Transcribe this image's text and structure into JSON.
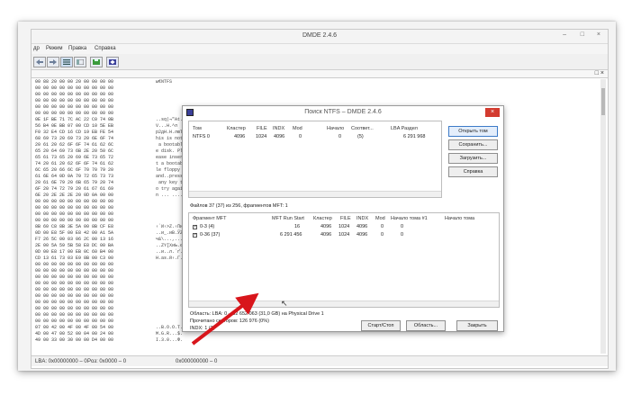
{
  "app": {
    "title": "DMDE 2.4.6",
    "window_controls": [
      "–",
      "□",
      "×"
    ],
    "menu": [
      "др",
      "Режим",
      "Правка",
      "Справка"
    ],
    "mdi_controls": "□ ×",
    "status": {
      "lba": "LBA: 0x00000000 – 0",
      "pos": "Poз: 0x0000 – 0",
      "offset": "0x000000000 – 0"
    }
  },
  "hex": {
    "rows": [
      "00 88 20 00 00 20 00 00 00 00",
      "00 00 00 00 00 00 00 00 00 00",
      "00 00 00 00 00 00 00 00 00 00",
      "00 00 00 00 00 00 00 00 00 00",
      "00 00 00 00 00 00 00 00 00 00",
      "00 00 00 00 00 00 00 00 00 00",
      "0E 1F BE 71 7C AC 22 C0 74 0B",
      "56 B4 0E BB 07 00 CD 10 5E EB",
      "F0 32 E4 CD 16 CD 19 EB FE 54",
      "68 69 73 20 69 73 20 6E 6F 74",
      "20 61 20 62 6F 6F 74 61 62 6C",
      "65 20 64 69 73 6B 2E 20 50 6C",
      "65 61 73 65 20 69 6E 73 65 72",
      "74 20 61 20 62 6F 6F 74 61 62",
      "6C 65 20 66 6C 6F 70 70 79 20",
      "61 6E 64 0D 0A 70 72 65 73 73",
      "20 61 6E 79 20 6B 65 79 20 74",
      "6F 20 74 72 79 20 61 67 61 69",
      "6E 20 2E 2E 2E 20 0D 0A 00 00",
      "00 00 00 00 00 00 00 00 00 00",
      "00 00 00 00 00 00 00 00 00 00",
      "00 00 00 00 00 00 00 00 00 00",
      "00 00 00 00 00 00 00 00 00 00",
      "8B 60 C8 8B 3E 5A 00 8B CF E8",
      "0D 00 E8 5F 00 E8 42 00 A1 5A",
      "F7 26 5C 00 03 06 2C 00 13 16",
      "2E 00 5A 59 5B 58 E8 DC 00 BA",
      "0D 00 E8 17 00 EB 0C 60 B4 00",
      "CD 13 61 73 03 E9 8B 00 C3 00",
      "00 00 00 00 00 00 00 00 00 00",
      "00 00 00 00 00 00 00 00 00 00",
      "00 00 00 00 00 00 00 00 00 00",
      "00 00 00 00 00 00 00 00 00 00",
      "00 00 00 00 00 00 00 00 00 00",
      "00 00 00 00 00 00 00 00 00 00",
      "00 00 00 00 00 00 00 00 00 00",
      "00 00 00 00 00 00 00 00 00 00",
      "00 00 00 00 00 00 00 00 00 00",
      "00 00 00 00 00 00 00 00 00 00",
      "07 00 42 00 4F 00 4F 00 54 00",
      "4D 00 47 00 52 00 04 00 24 00",
      "49 00 33 00 30 00 00 D4 00 00"
    ],
    "ascii": [
      "ы€NTFS",
      "",
      "",
      "",
      "",
      "",
      "..ѕq|¬\"Аt.",
      "V...Н.^л",
      "р2дН.Н.люT",
      "his is not",
      " a bootabl",
      "e disk. Pl",
      "ease inser",
      "t a bootab",
      "le floppy ",
      "and..press",
      " any key t",
      "o try agai",
      "n ... ....",
      "",
      "",
      "",
      "",
      "‹`И‹>Z.‹Пи",
      "..и_.иB.ЎZ",
      "ч&\\...,...",
      "..ZY[XиЬ.є",
      "..и..л.`ґ.",
      "Н.as.й‹.Г.",
      "",
      "",
      "",
      "",
      "",
      "",
      "",
      "",
      "",
      "",
      "..B.O.O.T.",
      "M.G.R...$.",
      "I.3.0...Ф."
    ]
  },
  "dialog": {
    "title": "Поиск NTFS – DMDE 2.4.6",
    "close": "×",
    "top_list": {
      "headers": [
        "Том",
        "Кластер",
        "FILE",
        "INDX",
        "Mod",
        "Начало",
        "Соответ...",
        "LBA Раздел"
      ],
      "rows": [
        [
          "NTFS 0",
          "4096",
          "1024",
          "4096",
          "0",
          "0",
          "(5)",
          "6 291 968"
        ]
      ]
    },
    "buttons_right": [
      "Открыть том",
      "Сохранить...",
      "Загрузить...",
      "Справка"
    ],
    "summary": "Файлов 37 (37) из 256, фрагментов MFT: 1",
    "frag_list": {
      "headers": [
        "Фрагмент MFT",
        "MFT Run Start",
        "Кластер",
        "FILE",
        "INDX",
        "Mod",
        "Начало тома #1",
        "Начало тома"
      ],
      "rows": [
        [
          "0-3 (4)",
          "16",
          "4096",
          "1024",
          "4096",
          "0",
          "0",
          ""
        ],
        [
          "0-36 (37)",
          "6 291 456",
          "4096",
          "1024",
          "4096",
          "0",
          "0",
          ""
        ]
      ]
    },
    "area": "Область: LBA: 0 – 62 652 063 (31,0 GB) на Physical Drive 1",
    "read_sectors": "Прочитано секторов: 126 976 (0%)",
    "indx": "INDX: 1 (2)",
    "buttons_bottom": [
      "Старт/Стоп",
      "Область...",
      "Закрыть"
    ]
  },
  "colors": {
    "arrow": "#d8151b",
    "dialog_close": "#d33b2f",
    "primary_border": "#3d7bc8",
    "toolbar_icon": "#3a3f99"
  }
}
